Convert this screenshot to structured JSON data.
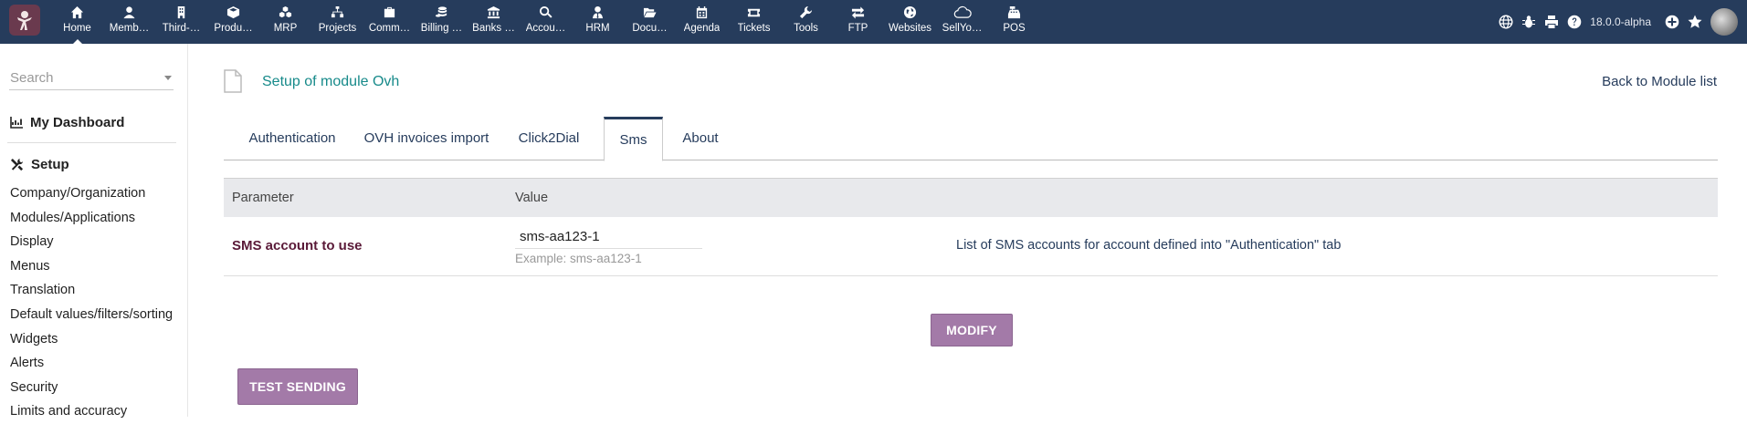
{
  "topbar": {
    "menu": [
      {
        "label": "Home",
        "icon": "home-icon"
      },
      {
        "label": "Memb…",
        "icon": "user-icon"
      },
      {
        "label": "Third-…",
        "icon": "building-icon"
      },
      {
        "label": "Produ…",
        "icon": "cube-icon"
      },
      {
        "label": "MRP",
        "icon": "cubes-icon"
      },
      {
        "label": "Projects",
        "icon": "sitemap-icon"
      },
      {
        "label": "Comm…",
        "icon": "suitcase-icon"
      },
      {
        "label": "Billing …",
        "icon": "coins-icon"
      },
      {
        "label": "Banks …",
        "icon": "bank-icon"
      },
      {
        "label": "Accou…",
        "icon": "search-dollar-icon"
      },
      {
        "label": "HRM",
        "icon": "user-tie-icon"
      },
      {
        "label": "Docu…",
        "icon": "folder-open-icon"
      },
      {
        "label": "Agenda",
        "icon": "calendar-icon"
      },
      {
        "label": "Tickets",
        "icon": "ticket-icon"
      },
      {
        "label": "Tools",
        "icon": "wrench-icon"
      },
      {
        "label": "FTP",
        "icon": "exchange-icon"
      },
      {
        "label": "Websites",
        "icon": "globe-icon"
      },
      {
        "label": "SellYo…",
        "icon": "cloud-icon"
      },
      {
        "label": "POS",
        "icon": "cash-register-icon"
      }
    ],
    "version": "18.0.0-alpha"
  },
  "sidebar": {
    "search_placeholder": "Search",
    "dashboard": "My Dashboard",
    "setup": "Setup",
    "items": [
      "Company/Organization",
      "Modules/Applications",
      "Display",
      "Menus",
      "Translation",
      "Default values/filters/sorting",
      "Widgets",
      "Alerts",
      "Security",
      "Limits and accuracy"
    ]
  },
  "main": {
    "title": "Setup of module Ovh",
    "back_link": "Back to Module list",
    "tabs": [
      "Authentication",
      "OVH invoices import",
      "Click2Dial",
      "Sms",
      "About"
    ],
    "active_tab": "Sms",
    "table": {
      "headers": [
        "Parameter",
        "Value"
      ],
      "row": {
        "parameter": "SMS account to use",
        "value": "sms-aa123-1",
        "hint": "Example: sms-aa123-1",
        "description": "List of SMS accounts for account defined into \"Authentication\" tab"
      }
    },
    "modify_button": "MODIFY",
    "test_button": "TEST SENDING"
  },
  "colors": {
    "topbar": "#263c5c",
    "button": "#a37aa8",
    "title": "#178a8a",
    "param_label": "#5a1a38"
  }
}
